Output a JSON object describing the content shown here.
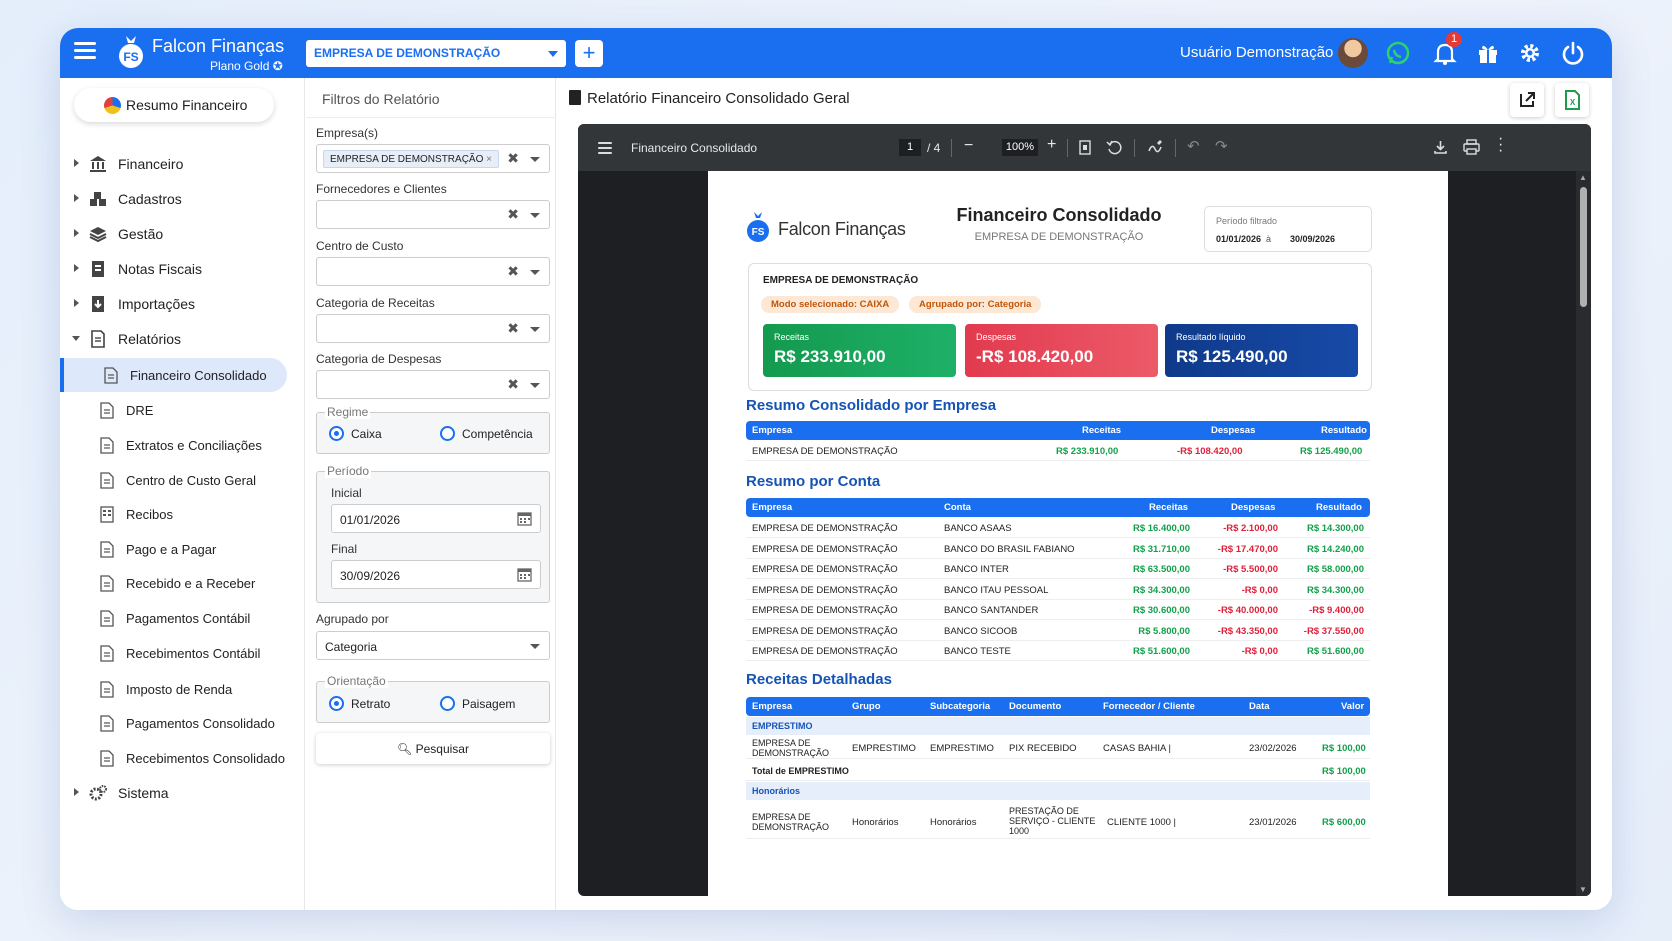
{
  "app": {
    "name": "Falcon Finanças",
    "plan": "Plano Gold"
  },
  "topbar": {
    "empresa": "EMPRESA DE DEMONSTRAÇÃO",
    "add": "+",
    "user": "Usuário Demonstração",
    "notifications": "1"
  },
  "sidebar": {
    "resumo": "Resumo Financeiro",
    "items": [
      {
        "label": "Financeiro",
        "icon": "bank-icon"
      },
      {
        "label": "Cadastros",
        "icon": "boxes-icon"
      },
      {
        "label": "Gestão",
        "icon": "layers-icon"
      },
      {
        "label": "Notas Fiscais",
        "icon": "invoice-icon"
      },
      {
        "label": "Importações",
        "icon": "import-icon"
      },
      {
        "label": "Relatórios",
        "icon": "report-icon"
      }
    ],
    "reports": [
      "Financeiro Consolidado",
      "DRE",
      "Extratos e Conciliações",
      "Centro de Custo Geral",
      "Recibos",
      "Pago e a Pagar",
      "Recebido e a Receber",
      "Pagamentos Contábil",
      "Recebimentos Contábil",
      "Imposto de Renda",
      "Pagamentos Consolidado",
      "Recebimentos Consolidado"
    ],
    "sistema": "Sistema"
  },
  "filters": {
    "title": "Filtros do Relatório",
    "empresas_label": "Empresa(s)",
    "empresa_chip": "EMPRESA DE DEMONSTRAÇÃO",
    "fornecedores_label": "Fornecedores e Clientes",
    "centro_label": "Centro de Custo",
    "cat_receitas_label": "Categoria de Receitas",
    "cat_despesas_label": "Categoria de Despesas",
    "regime_label": "Regime",
    "regime_caixa": "Caixa",
    "regime_competencia": "Competência",
    "periodo_label": "Período",
    "inicial_label": "Inicial",
    "inicial": "01/01/2026",
    "final_label": "Final",
    "final": "30/09/2026",
    "agrupado_label": "Agrupado por",
    "agrupado": "Categoria",
    "orientacao_label": "Orientação",
    "retrato": "Retrato",
    "paisagem": "Paisagem",
    "pesquisar": "Pesquisar"
  },
  "main": {
    "title": "Relatório Financeiro Consolidado Geral"
  },
  "viewer": {
    "doc_title": "Financeiro Consolidado",
    "page": "1",
    "pages": "/ 4",
    "zoom": "100%"
  },
  "report": {
    "brand": "Falcon Finanças",
    "title": "Financeiro Consolidado",
    "subtitle": "EMPRESA DE DEMONSTRAÇÃO",
    "periodo_label": "Período filtrado",
    "periodo_ini": "01/01/2026",
    "periodo_sep": "à",
    "periodo_fim": "30/09/2026",
    "card_company": "EMPRESA DE DEMONSTRAÇÃO",
    "modo": "Modo selecionado: CAIXA",
    "agrupado": "Agrupado por: Categoria",
    "kpis": {
      "receitas_label": "Receitas",
      "receitas": "R$ 233.910,00",
      "despesas_label": "Despesas",
      "despesas": "-R$ 108.420,00",
      "resultado_label": "Resultado líquido",
      "resultado": "R$ 125.490,00"
    },
    "sec1": "Resumo Consolidado por Empresa",
    "sec1_head": {
      "empresa": "Empresa",
      "receitas": "Receitas",
      "despesas": "Despesas",
      "resultado": "Resultado"
    },
    "sec1_row": {
      "empresa": "EMPRESA DE DEMONSTRAÇÃO",
      "receitas": "R$ 233.910,00",
      "despesas": "-R$ 108.420,00",
      "resultado": "R$ 125.490,00"
    },
    "sec2": "Resumo por Conta",
    "sec2_head": {
      "empresa": "Empresa",
      "conta": "Conta",
      "receitas": "Receitas",
      "despesas": "Despesas",
      "resultado": "Resultado"
    },
    "sec2_rows": [
      {
        "empresa": "EMPRESA DE DEMONSTRAÇÃO",
        "conta": "BANCO ASAAS",
        "receitas": "R$ 16.400,00",
        "despesas": "-R$ 2.100,00",
        "resultado": "R$ 14.300,00"
      },
      {
        "empresa": "EMPRESA DE DEMONSTRAÇÃO",
        "conta": "BANCO DO BRASIL FABIANO",
        "receitas": "R$ 31.710,00",
        "despesas": "-R$ 17.470,00",
        "resultado": "R$ 14.240,00"
      },
      {
        "empresa": "EMPRESA DE DEMONSTRAÇÃO",
        "conta": "BANCO INTER",
        "receitas": "R$ 63.500,00",
        "despesas": "-R$ 5.500,00",
        "resultado": "R$ 58.000,00"
      },
      {
        "empresa": "EMPRESA DE DEMONSTRAÇÃO",
        "conta": "BANCO ITAU PESSOAL",
        "receitas": "R$ 34.300,00",
        "despesas": "-R$ 0,00",
        "resultado": "R$ 34.300,00"
      },
      {
        "empresa": "EMPRESA DE DEMONSTRAÇÃO",
        "conta": "BANCO SANTANDER",
        "receitas": "R$ 30.600,00",
        "despesas": "-R$ 40.000,00",
        "resultado": "-R$ 9.400,00"
      },
      {
        "empresa": "EMPRESA DE DEMONSTRAÇÃO",
        "conta": "BANCO SICOOB",
        "receitas": "R$ 5.800,00",
        "despesas": "-R$ 43.350,00",
        "resultado": "-R$ 37.550,00"
      },
      {
        "empresa": "EMPRESA DE DEMONSTRAÇÃO",
        "conta": "BANCO TESTE",
        "receitas": "R$ 51.600,00",
        "despesas": "-R$ 0,00",
        "resultado": "R$ 51.600,00"
      }
    ],
    "sec3": "Receitas Detalhadas",
    "sec3_head": {
      "empresa": "Empresa",
      "grupo": "Grupo",
      "subcategoria": "Subcategoria",
      "documento": "Documento",
      "fornecedor": "Fornecedor / Cliente",
      "data": "Data",
      "valor": "Valor"
    },
    "grp1": "EMPRESTIMO",
    "grp1_row": {
      "empresa": "EMPRESA DE DEMONSTRAÇÃO",
      "grupo": "EMPRESTIMO",
      "subcategoria": "EMPRESTIMO",
      "documento": "PIX RECEBIDO",
      "fornecedor": "CASAS BAHIA |",
      "data": "23/02/2026",
      "valor": "R$ 100,00"
    },
    "grp1_total_label": "Total de EMPRESTIMO",
    "grp1_total": "R$ 100,00",
    "grp2": "Honorários",
    "grp2_row": {
      "empresa": "EMPRESA DE DEMONSTRAÇÃO",
      "grupo": "Honorários",
      "subcategoria": "Honorários",
      "documento": "PRESTAÇÃO DE SERVIÇO - CLIENTE 1000",
      "fornecedor": "CLIENTE 1000 |",
      "data": "23/01/2026",
      "valor": "R$ 600,00"
    }
  },
  "colors": {
    "primary": "#1a6ff0",
    "green": "#14a04a",
    "red": "#e0203a",
    "navy": "#143e8f"
  }
}
